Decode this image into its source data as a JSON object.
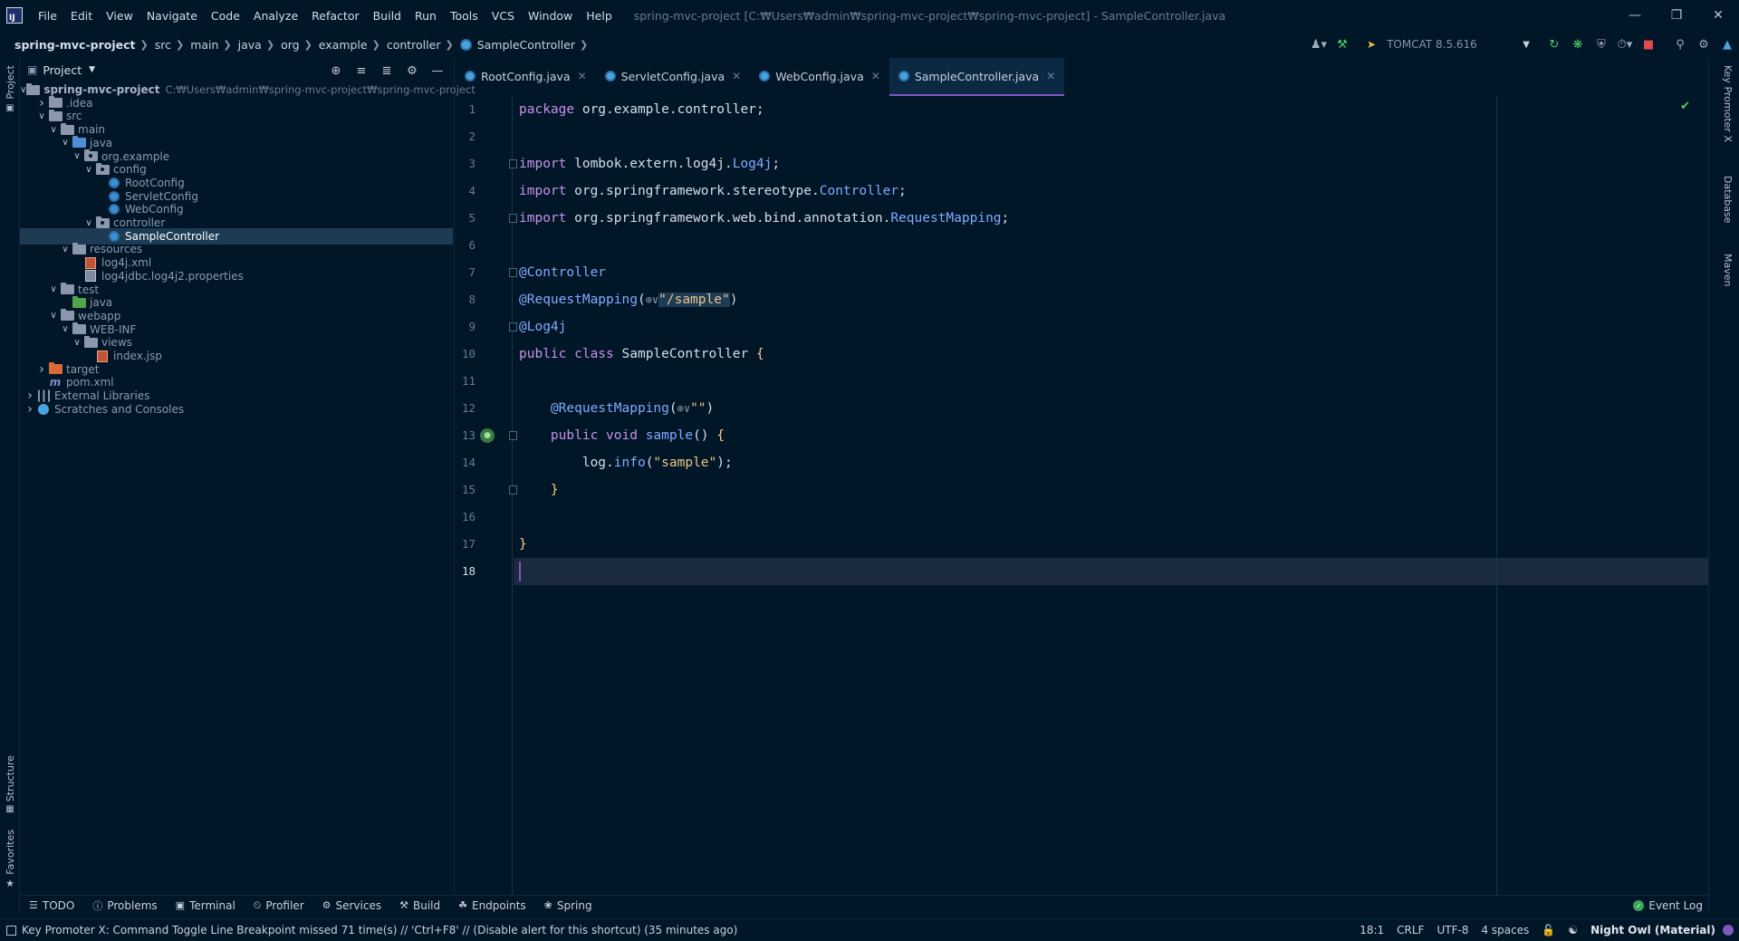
{
  "app": {
    "logo_text": "IJ",
    "menu": [
      "File",
      "Edit",
      "View",
      "Navigate",
      "Code",
      "Analyze",
      "Refactor",
      "Build",
      "Run",
      "Tools",
      "VCS",
      "Window",
      "Help"
    ],
    "window_title": "spring-mvc-project [C:₩Users₩admin₩spring-mvc-project₩spring-mvc-project] - SampleController.java"
  },
  "breadcrumb": [
    "spring-mvc-project",
    "src",
    "main",
    "java",
    "org",
    "example",
    "controller",
    "SampleController"
  ],
  "run_config": {
    "name": "TOMCAT 8.5.616"
  },
  "project_panel": {
    "title": "Project",
    "root_path": "C:₩Users₩admin₩spring-mvc-project₩spring-mvc-project",
    "tree": [
      {
        "label": "spring-mvc-project",
        "depth": 0,
        "arrow": "open",
        "icon": "folder-gray",
        "root": true
      },
      {
        "label": ".idea",
        "depth": 1,
        "arrow": "closed",
        "icon": "folder-gray"
      },
      {
        "label": "src",
        "depth": 1,
        "arrow": "open",
        "icon": "folder-gray"
      },
      {
        "label": "main",
        "depth": 2,
        "arrow": "open",
        "icon": "folder-gray"
      },
      {
        "label": "java",
        "depth": 3,
        "arrow": "open",
        "icon": "folder-blue"
      },
      {
        "label": "org.example",
        "depth": 4,
        "arrow": "open",
        "icon": "folder-pkg"
      },
      {
        "label": "config",
        "depth": 5,
        "arrow": "open",
        "icon": "folder-pkg"
      },
      {
        "label": "RootConfig",
        "depth": 6,
        "arrow": "none",
        "icon": "class"
      },
      {
        "label": "ServletConfig",
        "depth": 6,
        "arrow": "none",
        "icon": "class"
      },
      {
        "label": "WebConfig",
        "depth": 6,
        "arrow": "none",
        "icon": "class"
      },
      {
        "label": "controller",
        "depth": 5,
        "arrow": "open",
        "icon": "folder-pkg"
      },
      {
        "label": "SampleController",
        "depth": 6,
        "arrow": "none",
        "icon": "class",
        "selected": true
      },
      {
        "label": "resources",
        "depth": 3,
        "arrow": "open",
        "icon": "folder-gray"
      },
      {
        "label": "log4j.xml",
        "depth": 4,
        "arrow": "none",
        "icon": "xml"
      },
      {
        "label": "log4jdbc.log4j2.properties",
        "depth": 4,
        "arrow": "none",
        "icon": "properties"
      },
      {
        "label": "test",
        "depth": 2,
        "arrow": "open",
        "icon": "folder-gray"
      },
      {
        "label": "java",
        "depth": 3,
        "arrow": "none",
        "icon": "folder-green"
      },
      {
        "label": "webapp",
        "depth": 2,
        "arrow": "open",
        "icon": "folder-gray"
      },
      {
        "label": "WEB-INF",
        "depth": 3,
        "arrow": "open",
        "icon": "folder-gray"
      },
      {
        "label": "views",
        "depth": 4,
        "arrow": "open",
        "icon": "folder-gray"
      },
      {
        "label": "index.jsp",
        "depth": 5,
        "arrow": "none",
        "icon": "xml"
      },
      {
        "label": "target",
        "depth": 1,
        "arrow": "closed",
        "icon": "folder-orange"
      },
      {
        "label": "pom.xml",
        "depth": 1,
        "arrow": "none",
        "icon": "maven"
      },
      {
        "label": "External Libraries",
        "depth": 0,
        "arrow": "closed",
        "icon": "library"
      },
      {
        "label": "Scratches and Consoles",
        "depth": 0,
        "arrow": "closed",
        "icon": "scratch"
      }
    ]
  },
  "left_strip": {
    "project": "Project",
    "structure": "Structure",
    "favorites": "Favorites"
  },
  "right_strip": {
    "key_promoter": "Key Promoter X",
    "database": "Database",
    "maven": "Maven"
  },
  "editor_tabs": [
    {
      "label": "RootConfig.java",
      "active": false
    },
    {
      "label": "ServletConfig.java",
      "active": false
    },
    {
      "label": "WebConfig.java",
      "active": false
    },
    {
      "label": "SampleController.java",
      "active": true
    }
  ],
  "editor": {
    "current_line": 18,
    "lines": [
      [
        {
          "t": "package ",
          "c": "kw"
        },
        {
          "t": "org.example.controller",
          "c": "pun"
        },
        {
          "t": ";",
          "c": "pun"
        }
      ],
      [],
      [
        {
          "t": "import ",
          "c": "kw"
        },
        {
          "t": "lombok.extern.log4j.",
          "c": "pun"
        },
        {
          "t": "Log4j",
          "c": "cls"
        },
        {
          "t": ";",
          "c": "pun"
        }
      ],
      [
        {
          "t": "import ",
          "c": "kw"
        },
        {
          "t": "org.springframework.stereotype.",
          "c": "pun"
        },
        {
          "t": "Controller",
          "c": "cls"
        },
        {
          "t": ";",
          "c": "pun"
        }
      ],
      [
        {
          "t": "import ",
          "c": "kw"
        },
        {
          "t": "org.springframework.web.bind.annotation.",
          "c": "pun"
        },
        {
          "t": "RequestMapping",
          "c": "cls"
        },
        {
          "t": ";",
          "c": "pun"
        }
      ],
      [],
      [
        {
          "t": "@Controller",
          "c": "ann"
        }
      ],
      [
        {
          "t": "@RequestMapping",
          "c": "ann"
        },
        {
          "t": "(",
          "c": "pun"
        },
        {
          "t": "⊕∨",
          "c": "inlay"
        },
        {
          "t": "\"/sample\"",
          "c": "str hl-word"
        },
        {
          "t": ")",
          "c": "pun"
        }
      ],
      [
        {
          "t": "@Log4j",
          "c": "ann"
        }
      ],
      [
        {
          "t": "public class ",
          "c": "kw"
        },
        {
          "t": "SampleController ",
          "c": "pun"
        },
        {
          "t": "{",
          "c": "brace"
        }
      ],
      [],
      [
        {
          "t": "    @RequestMapping",
          "c": "ann"
        },
        {
          "t": "(",
          "c": "pun"
        },
        {
          "t": "⊕∨",
          "c": "inlay"
        },
        {
          "t": "\"\"",
          "c": "str"
        },
        {
          "t": ")",
          "c": "pun"
        }
      ],
      [
        {
          "t": "    public void ",
          "c": "kw"
        },
        {
          "t": "sample",
          "c": "fn"
        },
        {
          "t": "() ",
          "c": "pun"
        },
        {
          "t": "{",
          "c": "brace"
        }
      ],
      [
        {
          "t": "        log",
          "c": "pun"
        },
        {
          "t": ".",
          "c": "pun"
        },
        {
          "t": "info",
          "c": "fn"
        },
        {
          "t": "(",
          "c": "pun"
        },
        {
          "t": "\"sample\"",
          "c": "str"
        },
        {
          "t": ");",
          "c": "pun"
        }
      ],
      [
        {
          "t": "    }",
          "c": "brace"
        }
      ],
      [],
      [
        {
          "t": "}",
          "c": "brace"
        }
      ],
      []
    ]
  },
  "bottom_tabs": [
    "TODO",
    "Problems",
    "Terminal",
    "Profiler",
    "Services",
    "Build",
    "Endpoints",
    "Spring"
  ],
  "event_log": "Event Log",
  "status": {
    "message": "Key Promoter X: Command Toggle Line Breakpoint missed 71 time(s) // 'Ctrl+F8' // (Disable alert for this shortcut) (35 minutes ago)",
    "position": "18:1",
    "line_sep": "CRLF",
    "encoding": "UTF-8",
    "indent": "4 spaces",
    "theme": "Night Owl (Material)"
  }
}
